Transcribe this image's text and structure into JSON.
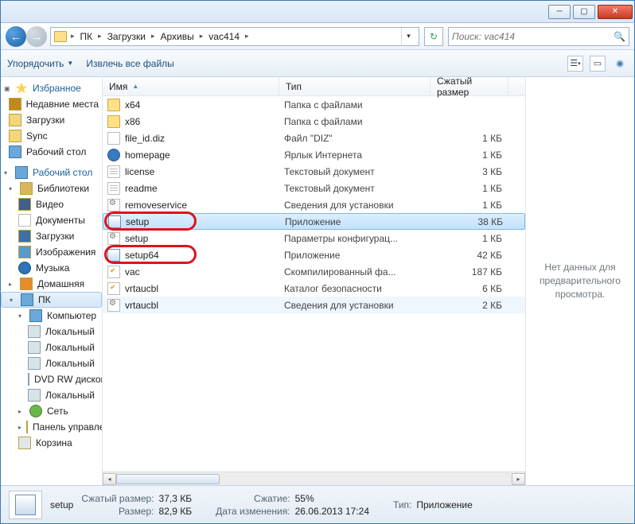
{
  "breadcrumbs": {
    "items": [
      "ПК",
      "Загрузки",
      "Архивы",
      "vac414"
    ]
  },
  "search": {
    "placeholder": "Поиск: vac414"
  },
  "toolbar": {
    "organize": "Упорядочить",
    "extract": "Извлечь все файлы"
  },
  "columns": {
    "name": "Имя",
    "type": "Тип",
    "size": "Сжатый размер"
  },
  "sidebar": {
    "favorites": {
      "label": "Избранное",
      "items": [
        "Недавние места",
        "Загрузки",
        "Sync",
        "Рабочий стол"
      ]
    },
    "desktop": {
      "label": "Рабочий стол",
      "libs": {
        "label": "Библиотеки",
        "items": [
          "Видео",
          "Документы",
          "Загрузки",
          "Изображения",
          "Музыка"
        ]
      },
      "home": "Домашняя",
      "pc": {
        "label": "ПК",
        "computer": "Компьютер",
        "drives": [
          "Локальный",
          "Локальный",
          "Локальный",
          "DVD RW дисковод",
          "Локальный"
        ]
      },
      "net": "Сеть",
      "panel": "Панель управления",
      "bin": "Корзина"
    }
  },
  "files": [
    {
      "name": "x64",
      "type": "Папка с файлами",
      "size": "",
      "icon": "folder"
    },
    {
      "name": "x86",
      "type": "Папка с файлами",
      "size": "",
      "icon": "folder"
    },
    {
      "name": "file_id.diz",
      "type": "Файл \"DIZ\"",
      "size": "1 КБ",
      "icon": "file"
    },
    {
      "name": "homepage",
      "type": "Ярлык Интернета",
      "size": "1 КБ",
      "icon": "globe"
    },
    {
      "name": "license",
      "type": "Текстовый документ",
      "size": "3 КБ",
      "icon": "txt"
    },
    {
      "name": "readme",
      "type": "Текстовый документ",
      "size": "1 КБ",
      "icon": "txt"
    },
    {
      "name": "removeservice",
      "type": "Сведения для установки",
      "size": "1 КБ",
      "icon": "cfg"
    },
    {
      "name": "setup",
      "type": "Приложение",
      "size": "38 КБ",
      "icon": "app",
      "selected": true,
      "circled": true
    },
    {
      "name": "setup",
      "type": "Параметры конфигурац...",
      "size": "1 КБ",
      "icon": "cfg"
    },
    {
      "name": "setup64",
      "type": "Приложение",
      "size": "42 КБ",
      "icon": "app",
      "circled": true
    },
    {
      "name": "vac",
      "type": "Скомпилированный фа...",
      "size": "187 КБ",
      "icon": "cert"
    },
    {
      "name": "vrtaucbl",
      "type": "Каталог безопасности",
      "size": "6 КБ",
      "icon": "cert"
    },
    {
      "name": "vrtaucbl",
      "type": "Сведения для установки",
      "size": "2 КБ",
      "icon": "cfg",
      "hover": true
    }
  ],
  "preview": {
    "empty": "Нет данных для предварительного просмотра."
  },
  "status": {
    "name": "setup",
    "csize_lbl": "Сжатый размер:",
    "csize": "37,3 КБ",
    "size_lbl": "Размер:",
    "size": "82,9 КБ",
    "comp_lbl": "Сжатие:",
    "comp": "55%",
    "date_lbl": "Дата изменения:",
    "date": "26.06.2013 17:24",
    "type_lbl": "Тип:",
    "type": "Приложение"
  }
}
